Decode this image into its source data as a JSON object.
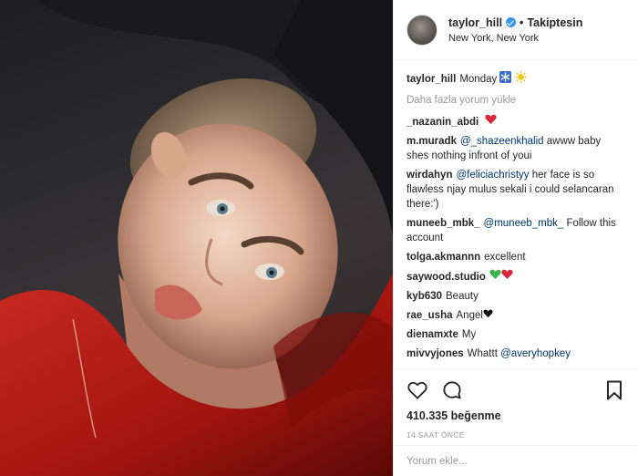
{
  "header": {
    "username": "taylor_hill",
    "follow_label": "Takiptesin",
    "separator": "•",
    "location": "New York, New York"
  },
  "caption": {
    "username": "taylor_hill",
    "text": "Monday"
  },
  "load_more_label": "Daha fazla yorum yükle",
  "comments": [
    {
      "username": "_nazanin_abdi",
      "text": "",
      "emoji": "red-heart"
    },
    {
      "username": "m.muradk",
      "mention": "@_shazeenkhalid",
      "text": "awww baby shes nothing infront of youi"
    },
    {
      "username": "wirdahyn",
      "mention": "@feliciachristyy",
      "text": "her face is so flawless njay mulus sekali i could selancaran there:')"
    },
    {
      "username": "muneeb_mbk_",
      "mention": "@muneeb_mbk_",
      "text": "Follow this account"
    },
    {
      "username": "tolga.akmannn",
      "text": "excellent"
    },
    {
      "username": "saywood.studio",
      "text": "",
      "emoji": "green-heart red-heart"
    },
    {
      "username": "kyb630",
      "text": "Beauty"
    },
    {
      "username": "rae_usha",
      "text": "Angel",
      "emoji": "black-heart"
    },
    {
      "username": "dienamxte",
      "text": "My"
    },
    {
      "username": "mivvyjones",
      "text": "Whattt",
      "mention": "@averyhopkey"
    }
  ],
  "actions": {
    "likes": "410.335 beğenme",
    "timestamp": "14 SAAT ÖNCE",
    "icons": [
      "heart-icon",
      "comment-icon",
      "bookmark-icon"
    ]
  },
  "add_comment": {
    "placeholder": "Yorum ekle..."
  },
  "colors": {
    "mention": "#003569",
    "muted": "#999999",
    "verified": "#3897f0",
    "text": "#262626",
    "border": "#efefef"
  }
}
